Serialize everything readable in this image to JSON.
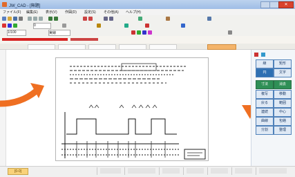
{
  "window": {
    "title": "JW_CAD - [無題]",
    "close_glyph": "✕"
  },
  "menubar": {
    "items": [
      "ファイル(F)",
      "編集(E)",
      "表示(V)",
      "作図(D)",
      "設定(S)",
      "その他(A)",
      "ヘルプ(H)"
    ]
  },
  "toolbar": {
    "layer_field": "0",
    "scale_field": "1/100",
    "line_field": "実線"
  },
  "bookmarks": {
    "tabs": [
      "",
      "",
      "",
      "",
      "",
      ""
    ]
  },
  "drawing": {
    "header_lines": 3,
    "title_block_label": ""
  },
  "right_panel": {
    "buttons": [
      [
        "線",
        "矩形"
      ],
      [
        "円",
        "文字"
      ],
      [
        "寸法",
        "消去"
      ],
      [
        "複写",
        "移動"
      ],
      [
        "戻る",
        "範囲"
      ],
      [
        "連続",
        "中心"
      ],
      [
        "曲線",
        "包絡"
      ],
      [
        "分割",
        "整理"
      ]
    ]
  },
  "statusbar": {
    "sheet_tab": "[0-0]",
    "segments": [
      "",
      "",
      "",
      "",
      "",
      "",
      ""
    ]
  },
  "colors": {
    "arrow": "#ef6f22",
    "accent_blue": "#2d6fb2",
    "accent_green": "#2f8f56"
  }
}
